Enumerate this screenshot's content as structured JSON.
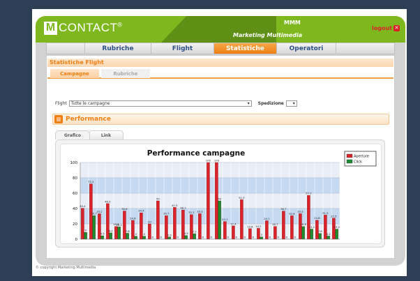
{
  "app": {
    "logo_letter": "M",
    "logo_text": "CONTACT",
    "logo_sup": "®",
    "brand_short": "MMM",
    "brand_long": "Marketing Multimedia",
    "logout_label": "logout"
  },
  "nav": {
    "items": [
      {
        "label": "Rubriche",
        "active": false
      },
      {
        "label": "Flight",
        "active": false
      },
      {
        "label": "Statistiche",
        "active": true
      },
      {
        "label": "Operatori",
        "active": false
      }
    ]
  },
  "section": {
    "title": "Statistiche Flight",
    "tabs": [
      "Campagne",
      "Rubriche"
    ],
    "flight_label": "Flight",
    "flight_value": "Tutte le campagne",
    "spedizione_label": "Spedizione",
    "spedizione_value": "",
    "performance_title": "Performance",
    "graph_tabs": [
      "Grafico",
      "Link"
    ]
  },
  "colors": {
    "accent_green": "#7fb81e",
    "accent_orange": "#ef7f12",
    "aperture": "#d8232a",
    "click": "#1f8a2f"
  },
  "chart_data": {
    "type": "bar",
    "title": "Performance campagne",
    "ylim": [
      0,
      100
    ],
    "yticks": [
      0,
      20,
      40,
      60,
      80,
      100
    ],
    "grid": true,
    "legend_position": "top-right",
    "series": [
      {
        "name": "Aperture",
        "values": [
          40.4,
          72.2,
          33.2,
          46.5,
          16.6,
          36.8,
          24.6,
          34.4,
          20,
          50,
          30.7,
          41.5,
          38.1,
          32.1,
          33.3,
          100,
          100,
          23.1,
          17.4,
          51.5,
          13.8,
          14.2,
          24.1,
          16.7,
          36.7,
          30.6,
          33.3,
          57.2,
          24.8,
          31.5,
          27.5
        ],
        "labels": [
          "40.4",
          "72.2",
          "33.2",
          "46.5",
          "16.6",
          "36.8",
          "24.6",
          "34.4",
          "20",
          "50",
          "30.7",
          "41.5",
          "38.1",
          "32.1",
          "33.3",
          "100",
          "100",
          "23.1",
          "17.4",
          "51.5",
          "13.8",
          "14.2",
          "24.1",
          "16.7",
          "36.7",
          "30.6",
          "33.3",
          "57.2",
          "24.8",
          "31.5",
          "27.5"
        ]
      },
      {
        "name": "Click",
        "values": [
          9,
          30.7,
          4.5,
          8.2,
          16.1,
          7.8,
          4,
          4,
          0,
          0,
          2.9,
          0,
          4.9,
          7.2,
          0,
          0,
          50,
          0,
          0,
          0,
          0,
          3,
          0,
          0,
          0,
          0,
          16.6,
          13.2,
          7.6,
          4.2,
          13.2
        ],
        "labels": [
          "9",
          "30.7",
          "4.5",
          "8.2",
          "16.1",
          "7.8",
          "4",
          "4",
          "0",
          "0",
          "2.9",
          "0",
          "4.9",
          "7.2",
          "0",
          "0",
          "50",
          "0",
          "0",
          "0",
          "0",
          "3",
          "0",
          "0",
          "0",
          "0",
          "16.6",
          "13.2",
          "7.6",
          "4.2",
          "13.2"
        ]
      }
    ]
  },
  "footer": {
    "copyright": "© copyright Marketing Multimedia"
  }
}
